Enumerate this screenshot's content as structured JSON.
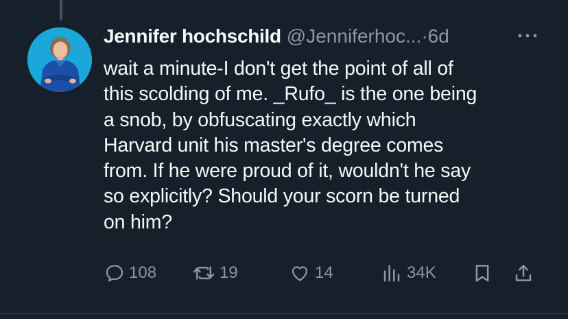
{
  "tweet": {
    "display_name": "Jennifer hochschild",
    "handle": "@Jenniferhoc...",
    "separator": "·",
    "time": "6d",
    "text": "wait a minute-I don't get the point of all of\nthis scolding of me. _Rufo_ is the one being\na snob, by obfuscating exactly which\nHarvard unit  his master's degree comes\nfrom. If he were proud of it, wouldn't he say\nso explicitly? Should your scorn be turned\non him?"
  },
  "actions": {
    "replies": "108",
    "retweets": "19",
    "likes": "14",
    "views": "34K"
  },
  "icons": {
    "reply": "speech-bubble-icon",
    "retweet": "retweet-arrows-icon",
    "like": "heart-icon",
    "views": "bar-chart-icon",
    "bookmark": "bookmark-icon",
    "share": "share-upload-icon",
    "more": "more-dots-icon"
  },
  "colors": {
    "background": "#15202b",
    "primary_text": "#f7f9f9",
    "secondary_text": "#8b98a5",
    "avatar_bg": "#1aa7d9"
  }
}
